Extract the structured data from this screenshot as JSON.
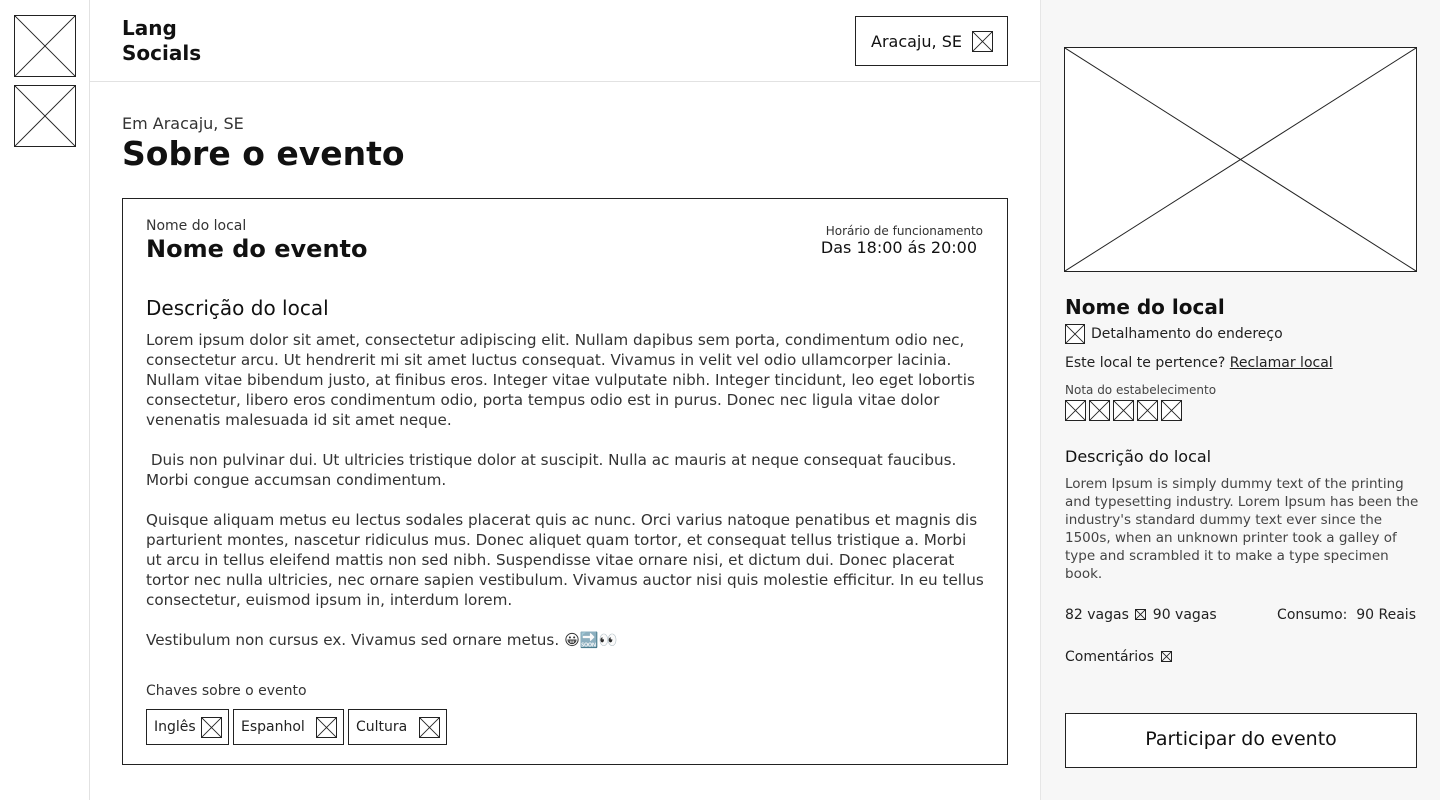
{
  "header": {
    "logo": "Lang\nSocials",
    "location": "Aracaju, SE",
    "location_icon": "placeholder-icon"
  },
  "main": {
    "pre_title": "Em Aracaju, SE",
    "title": "Sobre o evento",
    "card": {
      "venue_small": "Nome do local",
      "event_name": "Nome do evento",
      "hours_label": "Horário de funcionamento",
      "hours_value": "Das 18:00 ás 20:00",
      "desc_title": "Descrição do local",
      "paragraphs": [
        "Lorem ipsum dolor sit amet, consectetur adipiscing elit. Nullam dapibus sem porta, condimentum odio nec, consectetur arcu. Ut hendrerit mi sit amet luctus consequat. Vivamus in velit vel odio ullamcorper lacinia. Nullam vitae bibendum justo, at finibus eros. Integer vitae vulputate nibh. Integer tincidunt, leo eget lobortis consectetur, libero eros condimentum odio, porta tempus odio est in purus. Donec nec ligula vitae dolor venenatis malesuada id sit amet neque.",
        " Duis non pulvinar dui. Ut ultricies tristique dolor at suscipit. Nulla ac mauris at neque consequat faucibus. Morbi congue accumsan condimentum.",
        "Quisque aliquam metus eu lectus sodales placerat quis ac nunc. Orci varius natoque penatibus et magnis dis parturient montes, nascetur ridiculus mus. Donec aliquet quam tortor, et consequat tellus tristique a. Morbi ut arcu in tellus eleifend mattis non sed nibh. Suspendisse vitae ornare nisi, et dictum dui. Donec placerat tortor nec nulla ultricies, nec ornare sapien vestibulum. Vivamus auctor nisi quis molestie efficitur. In eu tellus consectetur, euismod ipsum in, interdum lorem.",
        "Vestibulum non cursus ex. Vivamus sed ornare metus. 😀🔜👀"
      ],
      "keys_label": "Chaves sobre o evento",
      "tags": [
        "Inglês",
        "Espanhol",
        "Cultura"
      ]
    }
  },
  "aside": {
    "venue_title": "Nome do local",
    "address": "Detalhamento do endereço",
    "owner_text": "Este local te pertence?",
    "claim_link": "Reclamar local",
    "rating_label": "Nota do estabelecimento",
    "rating_slots": 5,
    "desc_title": "Descrição do local",
    "desc": "Lorem Ipsum is simply dummy text of the printing and typesetting industry. Lorem Ipsum has been the industry's standard dummy text ever since the 1500s, when an unknown printer took a galley of type and scrambled it to make a type specimen book.",
    "vagas_a": "82 vagas",
    "vagas_b": "90 vagas",
    "consumo": "Consumo:  90 Reais",
    "comments": "Comentários",
    "cta": "Participar do evento"
  }
}
